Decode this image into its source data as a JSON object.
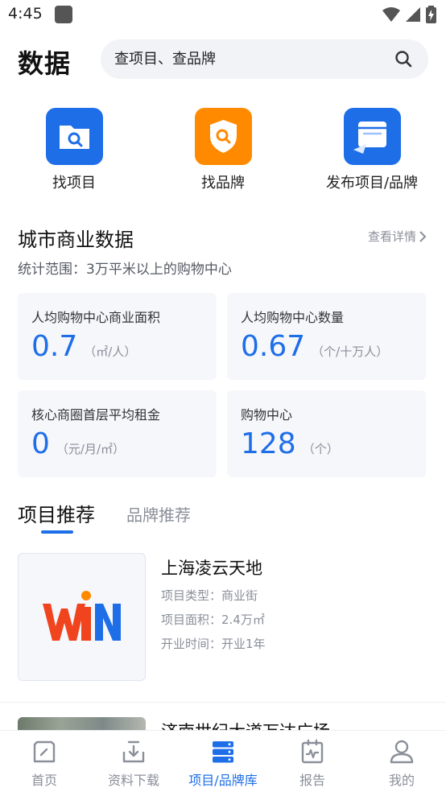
{
  "status": {
    "time": "4:45"
  },
  "header": {
    "title": "数据",
    "search_placeholder": "查项目、查品牌"
  },
  "quick_actions": [
    {
      "label": "找项目",
      "icon": "folder-search-icon"
    },
    {
      "label": "找品牌",
      "icon": "shield-search-icon"
    },
    {
      "label": "发布项目/品牌",
      "icon": "publish-window-icon"
    }
  ],
  "city_data": {
    "title": "城市商业数据",
    "detail_link": "查看详情",
    "scope": "统计范围：3万平米以上的购物中心",
    "stats": [
      {
        "label": "人均购物中心商业面积",
        "value": "0.7",
        "unit": "（㎡/人）"
      },
      {
        "label": "人均购物中心数量",
        "value": "0.67",
        "unit": "（个/十万人）"
      },
      {
        "label": "核心商圈首层平均租金",
        "value": "0",
        "unit": "（元/月/㎡）"
      },
      {
        "label": "购物中心",
        "value": "128",
        "unit": "（个）"
      }
    ]
  },
  "tabs": [
    {
      "label": "项目推荐",
      "active": true
    },
    {
      "label": "品牌推荐",
      "active": false
    }
  ],
  "projects": [
    {
      "name": "上海凌云天地",
      "logo_text": "WiN",
      "type": "项目类型：商业街",
      "area": "项目面积：2.4万㎡",
      "opening": "开业时间：开业1年"
    },
    {
      "name": "济南世纪大道万达广场"
    }
  ],
  "bottom_nav": [
    {
      "label": "首页",
      "icon": "home-icon",
      "active": false
    },
    {
      "label": "资料下载",
      "icon": "download-icon",
      "active": false
    },
    {
      "label": "项目/品牌库",
      "icon": "database-icon",
      "active": true
    },
    {
      "label": "报告",
      "icon": "report-icon",
      "active": false
    },
    {
      "label": "我的",
      "icon": "user-icon",
      "active": false
    }
  ],
  "colors": {
    "accent": "#1e6ee8",
    "orange": "#ff8a00",
    "logo_red": "#f0441f"
  }
}
